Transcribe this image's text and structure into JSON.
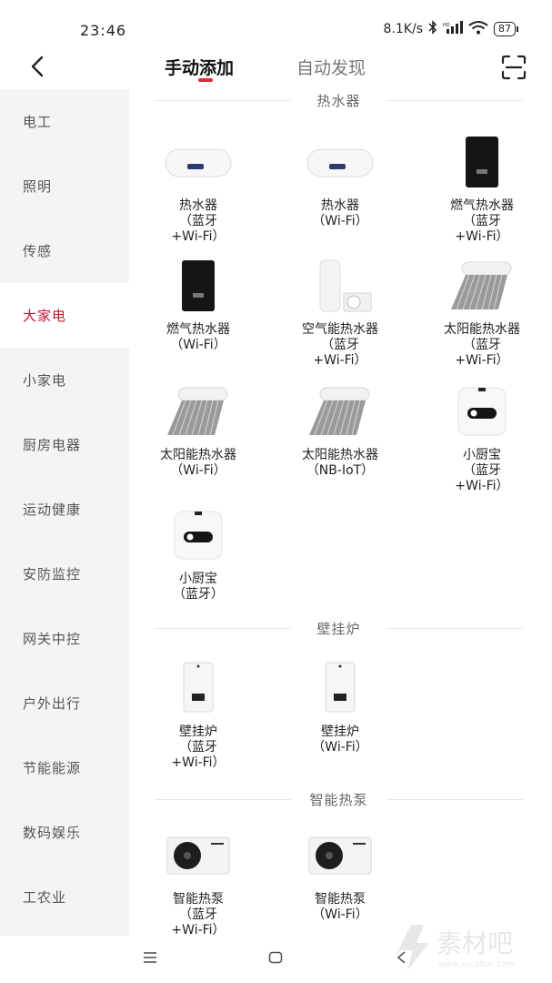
{
  "status": {
    "time": "23:46",
    "speed": "8.1K/s",
    "battery": "87"
  },
  "header": {
    "tab_manual": "手动添加",
    "tab_auto": "自动发现"
  },
  "sidebar": {
    "items": [
      {
        "label": "电工"
      },
      {
        "label": "照明"
      },
      {
        "label": "传感"
      },
      {
        "label": "大家电"
      },
      {
        "label": "小家电"
      },
      {
        "label": "厨房电器"
      },
      {
        "label": "运动健康"
      },
      {
        "label": "安防监控"
      },
      {
        "label": "网关中控"
      },
      {
        "label": "户外出行"
      },
      {
        "label": "节能能源"
      },
      {
        "label": "数码娱乐"
      },
      {
        "label": "工农业"
      }
    ],
    "active": "大家电"
  },
  "sections": [
    {
      "title": "热水器",
      "items": [
        {
          "name": "热水器\n（蓝牙\n+Wi-Fi）",
          "icon": "water-heater-tank"
        },
        {
          "name": "热水器\n（Wi-Fi）",
          "icon": "water-heater-tank"
        },
        {
          "name": "燃气热水器\n（蓝牙\n+Wi-Fi）",
          "icon": "gas-water-heater"
        },
        {
          "name": "燃气热水器\n（Wi-Fi）",
          "icon": "gas-water-heater"
        },
        {
          "name": "空气能热水器\n（蓝牙\n+Wi-Fi）",
          "icon": "air-source-water-heater"
        },
        {
          "name": "太阳能热水器\n（蓝牙\n+Wi-Fi）",
          "icon": "solar-water-heater"
        },
        {
          "name": "太阳能热水器\n（Wi-Fi）",
          "icon": "solar-water-heater"
        },
        {
          "name": "太阳能热水器\n（NB-IoT）",
          "icon": "solar-water-heater"
        },
        {
          "name": "小厨宝\n（蓝牙\n+Wi-Fi）",
          "icon": "kitchen-heater"
        },
        {
          "name": "小厨宝\n（蓝牙）",
          "icon": "kitchen-heater"
        }
      ]
    },
    {
      "title": "壁挂炉",
      "items": [
        {
          "name": "壁挂炉\n（蓝牙\n+Wi-Fi）",
          "icon": "wall-boiler"
        },
        {
          "name": "壁挂炉\n（Wi-Fi）",
          "icon": "wall-boiler"
        }
      ]
    },
    {
      "title": "智能热泵",
      "items": [
        {
          "name": "智能热泵\n（蓝牙\n+Wi-Fi）",
          "icon": "heat-pump"
        },
        {
          "name": "智能热泵\n（Wi-Fi）",
          "icon": "heat-pump"
        }
      ]
    }
  ],
  "watermark": {
    "text": "素材吧",
    "url_text": "www.sucaibar.com"
  },
  "colors": {
    "accent": "#c8102e",
    "indicator": "#e1293a",
    "sidebar_bg": "#f4f4f4"
  }
}
